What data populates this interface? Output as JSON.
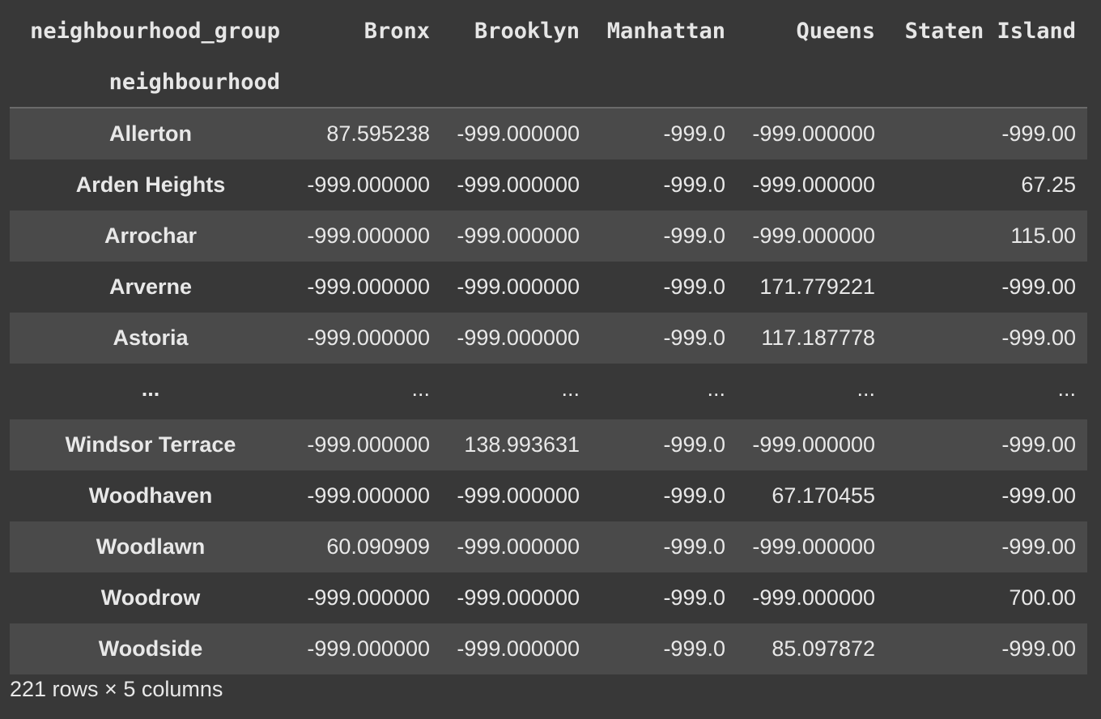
{
  "table": {
    "columns_name": "neighbourhood_group",
    "index_name": "neighbourhood",
    "columns": [
      "Bronx",
      "Brooklyn",
      "Manhattan",
      "Queens",
      "Staten Island"
    ],
    "rows": [
      {
        "label": "Allerton",
        "values": [
          "87.595238",
          "-999.000000",
          "-999.0",
          "-999.000000",
          "-999.00"
        ]
      },
      {
        "label": "Arden Heights",
        "values": [
          "-999.000000",
          "-999.000000",
          "-999.0",
          "-999.000000",
          "67.25"
        ]
      },
      {
        "label": "Arrochar",
        "values": [
          "-999.000000",
          "-999.000000",
          "-999.0",
          "-999.000000",
          "115.00"
        ]
      },
      {
        "label": "Arverne",
        "values": [
          "-999.000000",
          "-999.000000",
          "-999.0",
          "171.779221",
          "-999.00"
        ]
      },
      {
        "label": "Astoria",
        "values": [
          "-999.000000",
          "-999.000000",
          "-999.0",
          "117.187778",
          "-999.00"
        ]
      },
      {
        "label": "...",
        "values": [
          "...",
          "...",
          "...",
          "...",
          "..."
        ]
      },
      {
        "label": "Windsor Terrace",
        "values": [
          "-999.000000",
          "138.993631",
          "-999.0",
          "-999.000000",
          "-999.00"
        ]
      },
      {
        "label": "Woodhaven",
        "values": [
          "-999.000000",
          "-999.000000",
          "-999.0",
          "67.170455",
          "-999.00"
        ]
      },
      {
        "label": "Woodlawn",
        "values": [
          "60.090909",
          "-999.000000",
          "-999.0",
          "-999.000000",
          "-999.00"
        ]
      },
      {
        "label": "Woodrow",
        "values": [
          "-999.000000",
          "-999.000000",
          "-999.0",
          "-999.000000",
          "700.00"
        ]
      },
      {
        "label": "Woodside",
        "values": [
          "-999.000000",
          "-999.000000",
          "-999.0",
          "85.097872",
          "-999.00"
        ]
      }
    ],
    "footer": "221 rows × 5 columns"
  },
  "colors": {
    "background": "#383838",
    "row_stripe": "#4a4a4a",
    "text": "#e8e8e8",
    "rule": "#6a6a6a"
  }
}
